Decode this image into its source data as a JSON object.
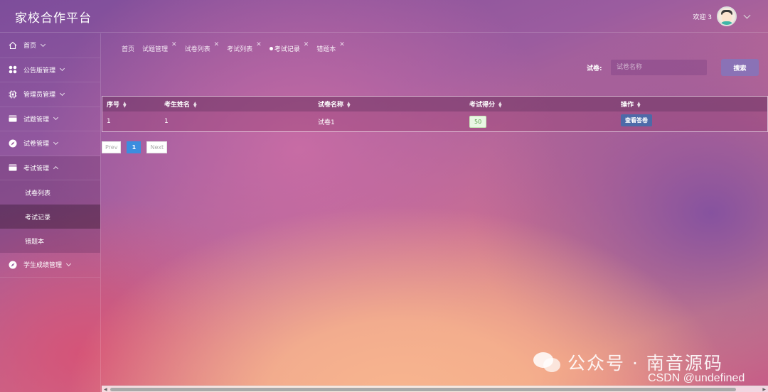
{
  "header": {
    "app_title": "家校合作平台",
    "welcome_text": "欢迎 3"
  },
  "sidebar": {
    "items": [
      {
        "label": "首页",
        "icon": "home-icon"
      },
      {
        "label": "公告版管理",
        "icon": "apps-icon"
      },
      {
        "label": "管理员管理",
        "icon": "chip-icon"
      },
      {
        "label": "试题管理",
        "icon": "card-icon"
      },
      {
        "label": "试卷管理",
        "icon": "compass-icon"
      },
      {
        "label": "考试管理",
        "icon": "card-icon",
        "expanded": true,
        "children": [
          {
            "label": "试卷列表"
          },
          {
            "label": "考试记录",
            "active": true
          },
          {
            "label": "错题本"
          }
        ]
      },
      {
        "label": "学生成绩管理",
        "icon": "compass-icon"
      }
    ]
  },
  "tabs": [
    {
      "label": "首页",
      "closable": false
    },
    {
      "label": "试题管理",
      "closable": true
    },
    {
      "label": "试卷列表",
      "closable": true
    },
    {
      "label": "考试列表",
      "closable": true
    },
    {
      "label": "考试记录",
      "closable": true,
      "active": true
    },
    {
      "label": "错题本",
      "closable": true
    }
  ],
  "search": {
    "label": "试卷:",
    "placeholder": "试卷名称",
    "button_label": "搜索"
  },
  "table": {
    "columns": [
      "序号",
      "考生姓名",
      "试卷名称",
      "考试得分",
      "操作"
    ],
    "rows": [
      {
        "index": "1",
        "student": "1",
        "paper": "试卷1",
        "score": "50",
        "action_label": "查看答卷"
      }
    ]
  },
  "pagination": {
    "prev": "Prev",
    "current": "1",
    "next": "Next"
  },
  "watermark": {
    "text": "公众号 · 南音源码",
    "csdn": "CSDN @undefined"
  },
  "colors": {
    "accent": "#3c8dde",
    "search_button": "#8a72b6",
    "view_button": "#4d6aa8",
    "score_badge": "#eaf7e4"
  }
}
